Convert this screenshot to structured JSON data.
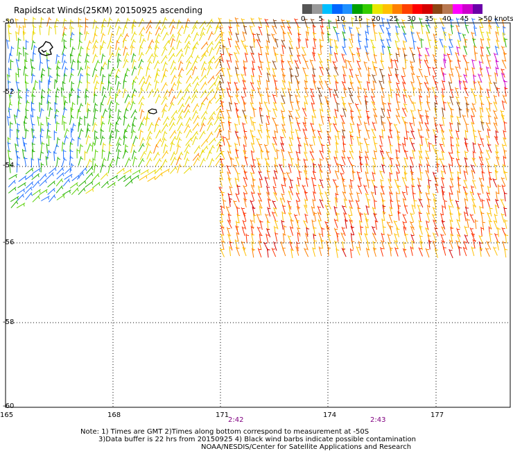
{
  "title": "Rapidscat Winds(25KM) 20150925 ascending",
  "legend": {
    "colors": [
      "#555555",
      "#999999",
      "#00bfff",
      "#0066ff",
      "#1e90ff",
      "#00a000",
      "#33cc00",
      "#e8e800",
      "#ffc000",
      "#ff8000",
      "#ff4000",
      "#ff0000",
      "#d40000",
      "#8b4513",
      "#b87850",
      "#ff00ff",
      "#cc00cc",
      "#6a00a8"
    ],
    "ticks": [
      "0",
      "5",
      "10",
      "15",
      "20",
      "25",
      "30",
      "35",
      "40",
      "45",
      ">50 knots"
    ]
  },
  "axes": {
    "lat_labels": [
      "-50",
      "-52",
      "-54",
      "-56",
      "-58",
      "-60"
    ],
    "lon_labels": [
      "165",
      "168",
      "171",
      "174",
      "177"
    ]
  },
  "time_labels": [
    "2:42",
    "2:43"
  ],
  "notes": {
    "line1": "Note: 1) Times are GMT 2)Times along bottom correspond to measurement at -50S",
    "line2": "3)Data buffer is 22 hrs from 20150925 4) Black wind barbs indicate possible contamination",
    "line3": "NOAA/NESDIS/Center for Satellite Applications and Research"
  },
  "colors": {
    "grid": "#000000",
    "time": "#800080"
  }
}
